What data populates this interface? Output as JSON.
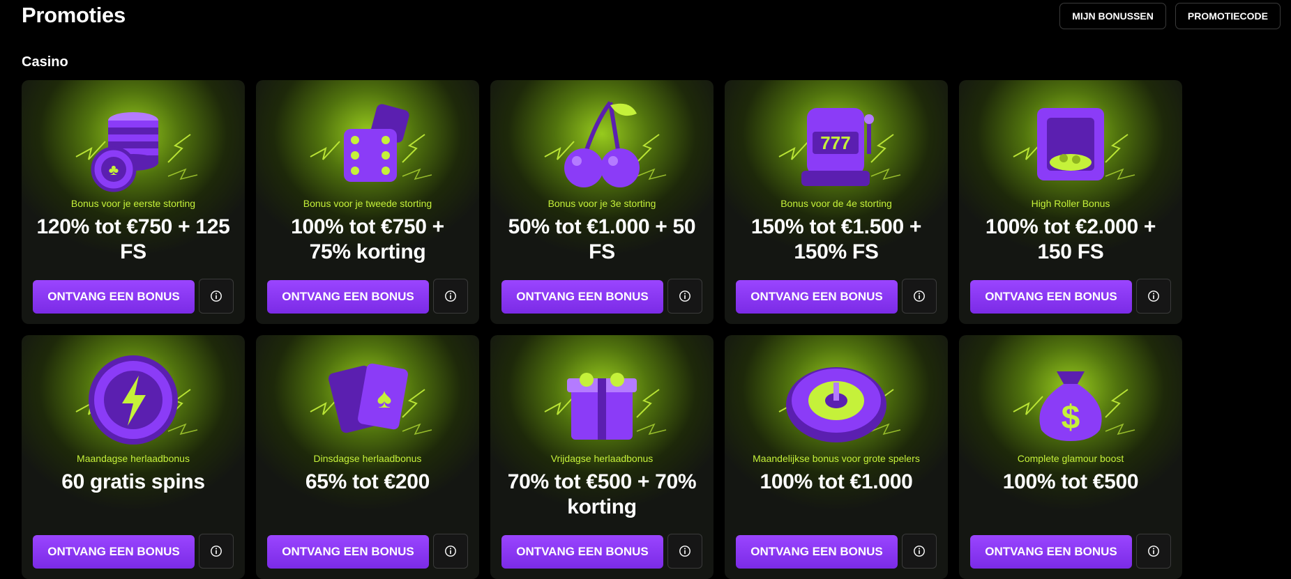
{
  "page": {
    "title": "Promoties"
  },
  "header": {
    "my_bonuses": "MIJN BONUSSEN",
    "promo_code": "PROMOTIECODE"
  },
  "section": {
    "title": "Casino"
  },
  "colors": {
    "accent": "#8b3cf7",
    "subtitle": "#c5f13a",
    "glow": "#9ed41e"
  },
  "cards": [
    {
      "icon": "casino-chips-icon",
      "subtitle": "Bonus voor je eerste storting",
      "headline": "120% tot €750 + 125 FS",
      "button": "ONTVANG EEN BONUS"
    },
    {
      "icon": "dice-icon",
      "subtitle": "Bonus voor je tweede storting",
      "headline": "100% tot €750 + 75% korting",
      "button": "ONTVANG EEN BONUS"
    },
    {
      "icon": "cherries-icon",
      "subtitle": "Bonus voor je 3e storting",
      "headline": "50% tot €1.000 + 50 FS",
      "button": "ONTVANG EEN BONUS"
    },
    {
      "icon": "slot-machine-icon",
      "subtitle": "Bonus voor de 4e storting",
      "headline": "150% tot €1.500 + 150% FS",
      "button": "ONTVANG EEN BONUS"
    },
    {
      "icon": "safe-icon",
      "subtitle": "High Roller Bonus",
      "headline": "100% tot €2.000 + 150 FS",
      "button": "ONTVANG EEN BONUS"
    },
    {
      "icon": "lightning-chip-icon",
      "subtitle": "Maandagse herlaadbonus",
      "headline": "60 gratis spins",
      "button": "ONTVANG EEN BONUS"
    },
    {
      "icon": "playing-cards-icon",
      "subtitle": "Dinsdagse herlaadbonus",
      "headline": "65% tot €200",
      "button": "ONTVANG EEN BONUS"
    },
    {
      "icon": "gift-box-icon",
      "subtitle": "Vrijdagse herlaadbonus",
      "headline": "70% tot €500 + 70% korting",
      "button": "ONTVANG EEN BONUS"
    },
    {
      "icon": "roulette-wheel-icon",
      "subtitle": "Maandelijkse bonus voor grote spelers",
      "headline": "100% tot €1.000",
      "button": "ONTVANG EEN BONUS"
    },
    {
      "icon": "money-bag-icon",
      "subtitle": "Complete glamour boost",
      "headline": "100% tot €500",
      "button": "ONTVANG EEN BONUS"
    }
  ]
}
